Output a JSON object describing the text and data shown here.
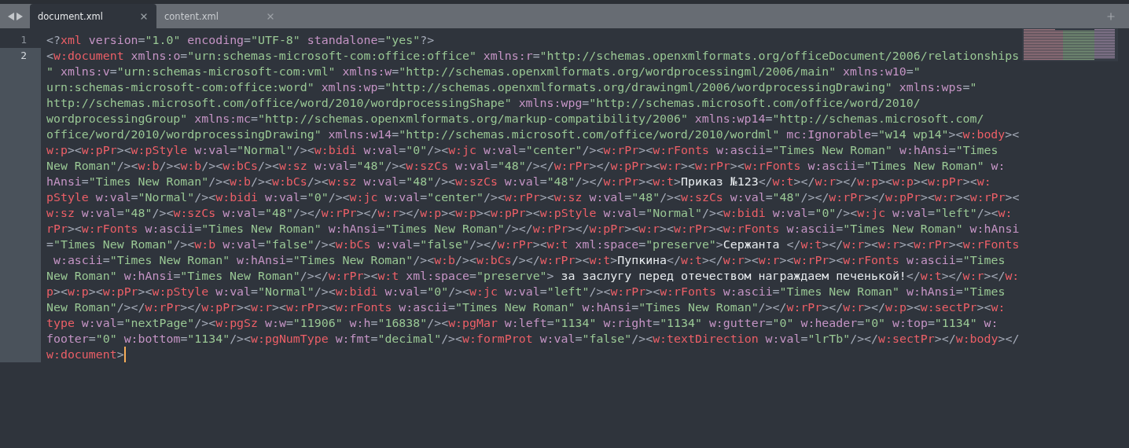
{
  "tabs": [
    {
      "label": "document.xml",
      "selected": true
    },
    {
      "label": "content.xml",
      "selected": false
    }
  ],
  "lines": [
    {
      "number": "1",
      "current": false,
      "rows": [
        "<?xml version=\"1.0\" encoding=\"UTF-8\" standalone=\"yes\"?>"
      ]
    },
    {
      "number": "2",
      "current": true,
      "rows": [
        "<w:document xmlns:o=\"urn:schemas-microsoft-com:office:office\" xmlns:r=\"http://schemas.openxmlformats.org/officeDocument/2006/relationships",
        "\" xmlns:v=\"urn:schemas-microsoft-com:vml\" xmlns:w=\"http://schemas.openxmlformats.org/wordprocessingml/2006/main\" xmlns:w10=\"",
        "urn:schemas-microsoft-com:office:word\" xmlns:wp=\"http://schemas.openxmlformats.org/drawingml/2006/wordprocessingDrawing\" xmlns:wps=\"",
        "http://schemas.microsoft.com/office/word/2010/wordprocessingShape\" xmlns:wpg=\"http://schemas.microsoft.com/office/word/2010/",
        "wordprocessingGroup\" xmlns:mc=\"http://schemas.openxmlformats.org/markup-compatibility/2006\" xmlns:wp14=\"http://schemas.microsoft.com/",
        "office/word/2010/wordprocessingDrawing\" xmlns:w14=\"http://schemas.microsoft.com/office/word/2010/wordml\" mc:Ignorable=\"w14 wp14\"><w:body><",
        "w:p><w:pPr><w:pStyle w:val=\"Normal\"/><w:bidi w:val=\"0\"/><w:jc w:val=\"center\"/><w:rPr><w:rFonts w:ascii=\"Times New Roman\" w:hAnsi=\"Times",
        "New Roman\"/><w:b/><w:b/><w:bCs/><w:sz w:val=\"48\"/><w:szCs w:val=\"48\"/></w:rPr></w:pPr><w:r><w:rPr><w:rFonts w:ascii=\"Times New Roman\" w:",
        "hAnsi=\"Times New Roman\"/><w:b/><w:bCs/><w:sz w:val=\"48\"/><w:szCs w:val=\"48\"/></w:rPr><w:t>Приказ №123</w:t></w:r></w:p><w:p><w:pPr><w:",
        "pStyle w:val=\"Normal\"/><w:bidi w:val=\"0\"/><w:jc w:val=\"center\"/><w:rPr><w:sz w:val=\"48\"/><w:szCs w:val=\"48\"/></w:rPr></w:pPr><w:r><w:rPr><",
        "w:sz w:val=\"48\"/><w:szCs w:val=\"48\"/></w:rPr></w:r></w:p><w:p><w:pPr><w:pStyle w:val=\"Normal\"/><w:bidi w:val=\"0\"/><w:jc w:val=\"left\"/><w:",
        "rPr><w:rFonts w:ascii=\"Times New Roman\" w:hAnsi=\"Times New Roman\"/></w:rPr></w:pPr><w:r><w:rPr><w:rFonts w:ascii=\"Times New Roman\" w:hAnsi",
        "=\"Times New Roman\"/><w:b w:val=\"false\"/><w:bCs w:val=\"false\"/></w:rPr><w:t xml:space=\"preserve\">Сержанта </w:t></w:r><w:r><w:rPr><w:rFonts",
        " w:ascii=\"Times New Roman\" w:hAnsi=\"Times New Roman\"/><w:b/><w:bCs/></w:rPr><w:t>Пупкина</w:t></w:r><w:r><w:rPr><w:rFonts w:ascii=\"Times",
        "New Roman\" w:hAnsi=\"Times New Roman\"/></w:rPr><w:t xml:space=\"preserve\"> за заслугу перед отечеством награждаем печенькой!</w:t></w:r></w:",
        "p><w:p><w:pPr><w:pStyle w:val=\"Normal\"/><w:bidi w:val=\"0\"/><w:jc w:val=\"left\"/><w:rPr><w:rFonts w:ascii=\"Times New Roman\" w:hAnsi=\"Times",
        "New Roman\"/></w:rPr></w:pPr><w:r><w:rPr><w:rFonts w:ascii=\"Times New Roman\" w:hAnsi=\"Times New Roman\"/></w:rPr></w:r></w:p><w:sectPr><w:",
        "type w:val=\"nextPage\"/><w:pgSz w:w=\"11906\" w:h=\"16838\"/><w:pgMar w:left=\"1134\" w:right=\"1134\" w:gutter=\"0\" w:header=\"0\" w:top=\"1134\" w:",
        "footer=\"0\" w:bottom=\"1134\"/><w:pgNumType w:fmt=\"decimal\"/><w:formProt w:val=\"false\"/><w:textDirection w:val=\"lrTb\"/></w:sectPr></w:body></",
        "w:document>"
      ]
    }
  ]
}
